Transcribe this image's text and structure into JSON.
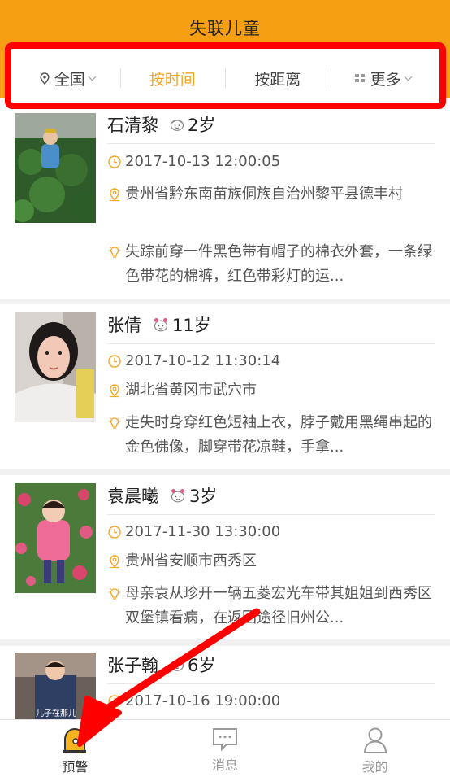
{
  "header": {
    "title": "失联儿童"
  },
  "filters": [
    {
      "label": "全国",
      "icon": "location-pin-icon"
    },
    {
      "label": "按时间",
      "active": true
    },
    {
      "label": "按距离"
    },
    {
      "label": "更多",
      "icon": "grid-icon"
    }
  ],
  "children": [
    {
      "name": "石清黎",
      "age": "2岁",
      "gender": "boy",
      "time": "2017-10-13 12:00:05",
      "place": "贵州省黔东南苗族侗族自治州黎平县德丰村",
      "description": "失踪前穿一件黑色带有帽子的棉衣外套，一条绿色带花的棉裤，红色带彩灯的运..."
    },
    {
      "name": "张倩",
      "age": "11岁",
      "gender": "girl",
      "time": "2017-10-12 11:30:14",
      "place": "湖北省黄冈市武穴市",
      "description": "走失时身穿红色短袖上衣，脖子戴用黑绳串起的金色佛像，脚穿带花凉鞋，手拿..."
    },
    {
      "name": "袁晨曦",
      "age": "3岁",
      "gender": "girl",
      "time": "2017-11-30 13:30:00",
      "place": "贵州省安顺市西秀区",
      "description": "母亲袁从珍开一辆五菱宏光车带其姐姐到西秀区双堡镇看病，在返回途径旧州公..."
    },
    {
      "name": "张子翰",
      "age": "6岁",
      "gender": "boy",
      "time": "2017-10-16 19:00:00",
      "photo_caption": "儿子在那儿"
    }
  ],
  "tabs": [
    {
      "label": "预警",
      "icon": "alert-bell-icon",
      "active": true
    },
    {
      "label": "消息",
      "icon": "message-icon"
    },
    {
      "label": "我的",
      "icon": "user-icon"
    }
  ],
  "colors": {
    "header": "#f79f12",
    "accent": "#f5a623",
    "annotation": "#ff0000"
  }
}
